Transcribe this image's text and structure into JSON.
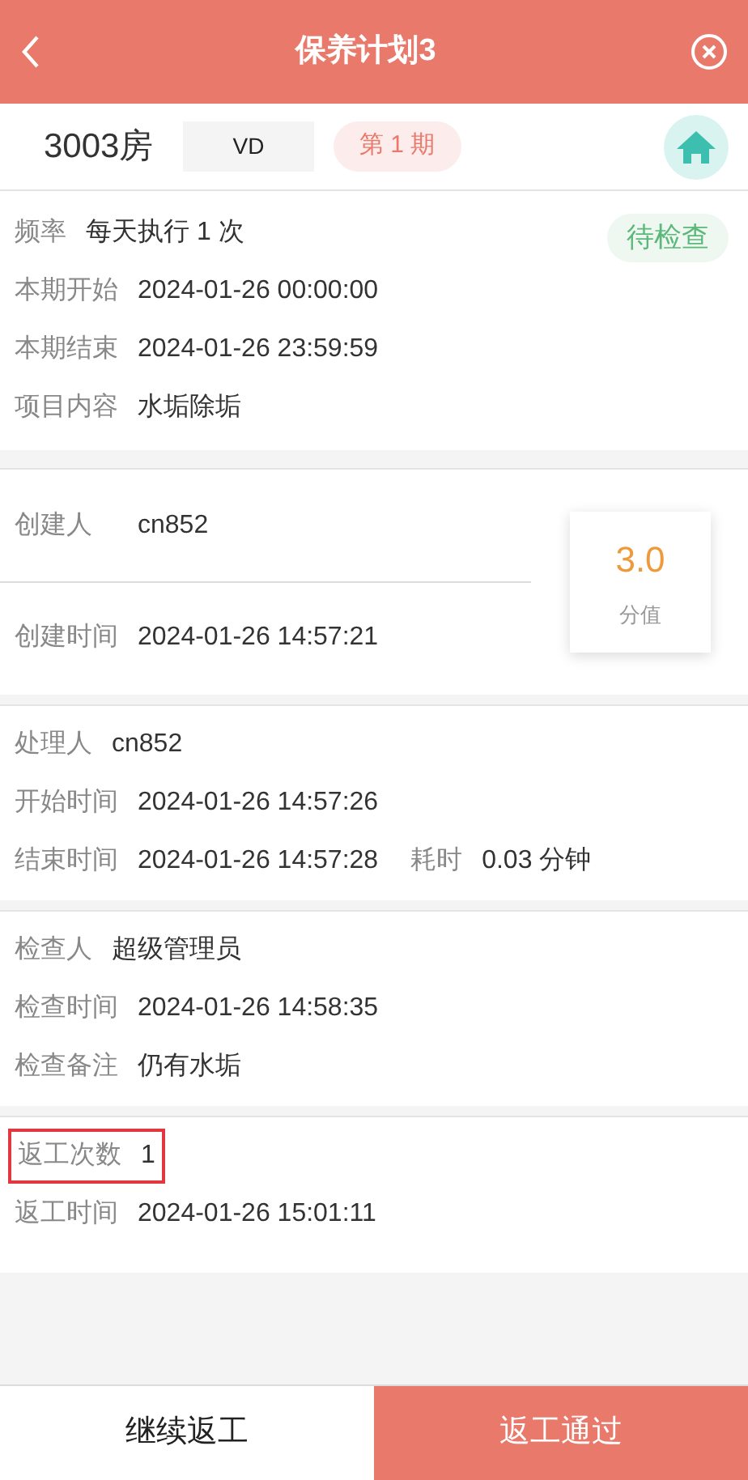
{
  "header": {
    "title": "保养计划3"
  },
  "room": {
    "name": "3003房",
    "status": "VD",
    "period": "第 1 期"
  },
  "plan": {
    "badge": "待检查",
    "rows": [
      {
        "label": "频率",
        "value": "每天执行 1 次"
      },
      {
        "label": "本期开始",
        "value": "2024-01-26 00:00:00"
      },
      {
        "label": "本期结束",
        "value": "2024-01-26 23:59:59"
      },
      {
        "label": "项目内容",
        "value": "水垢除垢"
      }
    ]
  },
  "creation": {
    "rows": [
      {
        "label": "创建人",
        "value": "cn852"
      },
      {
        "label": "创建时间",
        "value": "2024-01-26 14:57:21"
      }
    ],
    "score": {
      "value": "3.0",
      "label": "分值"
    }
  },
  "sections": [
    {
      "rows": [
        {
          "label": "处理人",
          "value": "cn852",
          "highlighted": false
        },
        {
          "label": "开始时间",
          "value": "2024-01-26 14:57:26",
          "highlighted": false
        },
        {
          "label": "结束时间",
          "value": "2024-01-26 14:57:28",
          "extra_label": "耗时",
          "extra_value": "0.03 分钟",
          "highlighted": false
        }
      ]
    },
    {
      "rows": [
        {
          "label": "检查人",
          "value": "超级管理员",
          "highlighted": false
        },
        {
          "label": "检查时间",
          "value": "2024-01-26 14:58:35",
          "highlighted": false
        },
        {
          "label": "检查备注",
          "value": "仍有水垢",
          "highlighted": false
        }
      ]
    },
    {
      "rows": [
        {
          "label": "返工次数",
          "value": "1",
          "highlighted": true
        },
        {
          "label": "返工时间",
          "value": "2024-01-26 15:01:11",
          "highlighted": false
        }
      ]
    }
  ],
  "actions": [
    {
      "label": "继续返工",
      "kind": "secondary"
    },
    {
      "label": "返工通过",
      "kind": "primary"
    }
  ]
}
